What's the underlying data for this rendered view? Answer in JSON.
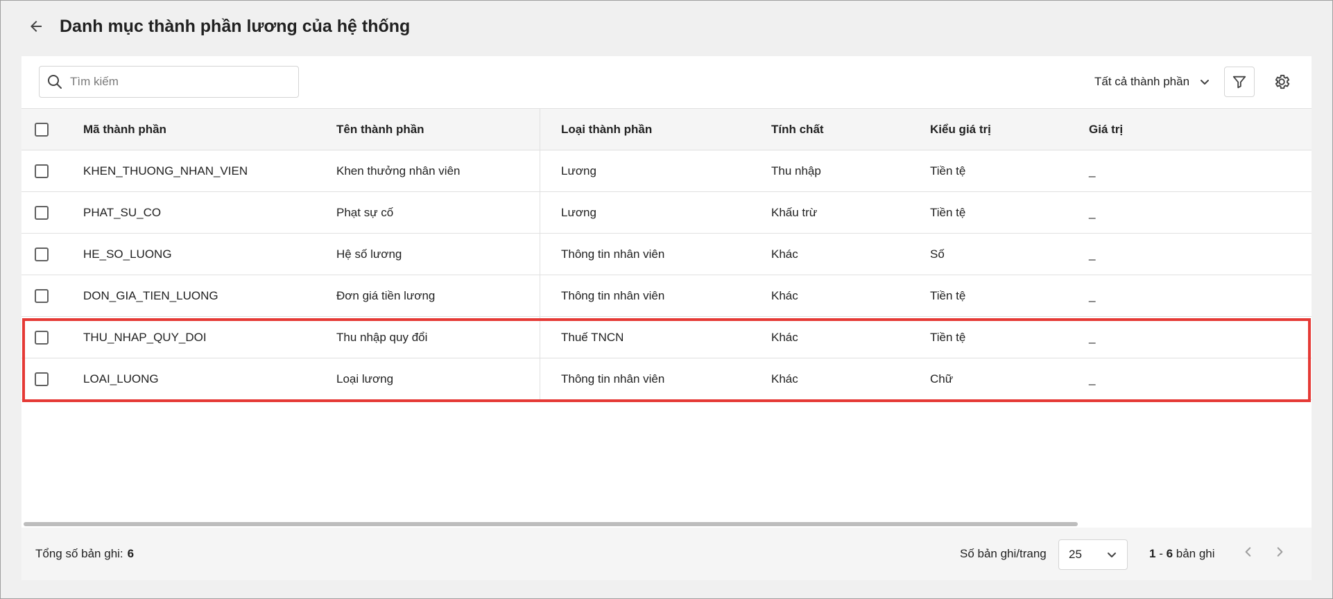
{
  "header": {
    "title": "Danh mục thành phần lương của hệ thống"
  },
  "toolbar": {
    "search_placeholder": "Tìm kiếm",
    "filter_selected": "Tất cả thành phần"
  },
  "table": {
    "columns": [
      "Mã thành phần",
      "Tên thành phần",
      "Loại thành phần",
      "Tính chất",
      "Kiểu giá trị",
      "Giá trị"
    ],
    "rows": [
      {
        "code": "KHEN_THUONG_NHAN_VIEN",
        "name": "Khen thưởng nhân viên",
        "type": "Lương",
        "property": "Thu nhập",
        "value_type": "Tiền tệ",
        "value": "_"
      },
      {
        "code": "PHAT_SU_CO",
        "name": "Phạt sự cố",
        "type": "Lương",
        "property": "Khấu trừ",
        "value_type": "Tiền tệ",
        "value": "_"
      },
      {
        "code": "HE_SO_LUONG",
        "name": "Hệ số lương",
        "type": "Thông tin nhân viên",
        "property": "Khác",
        "value_type": "Số",
        "value": "_"
      },
      {
        "code": "DON_GIA_TIEN_LUONG",
        "name": "Đơn giá tiền lương",
        "type": "Thông tin nhân viên",
        "property": "Khác",
        "value_type": "Tiền tệ",
        "value": "_"
      },
      {
        "code": "THU_NHAP_QUY_DOI",
        "name": "Thu nhập quy đổi",
        "type": "Thuế TNCN",
        "property": "Khác",
        "value_type": "Tiền tệ",
        "value": "_"
      },
      {
        "code": "LOAI_LUONG",
        "name": "Loại lương",
        "type": "Thông tin nhân viên",
        "property": "Khác",
        "value_type": "Chữ",
        "value": "_"
      }
    ]
  },
  "footer": {
    "total_label": "Tổng số bản ghi:",
    "total_value": "6",
    "per_page_label": "Số bản ghi/trang",
    "per_page_value": "25",
    "range_start": "1",
    "range_sep": " - ",
    "range_end": "6",
    "range_suffix": " bản ghi"
  },
  "colors": {
    "highlight": "#e53935",
    "header_bg": "#f5f5f5",
    "page_bg": "#f0f0f0"
  },
  "icons": [
    "back-arrow-icon",
    "search-icon",
    "chevron-down-icon",
    "filter-icon",
    "gear-icon",
    "chevron-left-icon",
    "chevron-right-icon"
  ]
}
